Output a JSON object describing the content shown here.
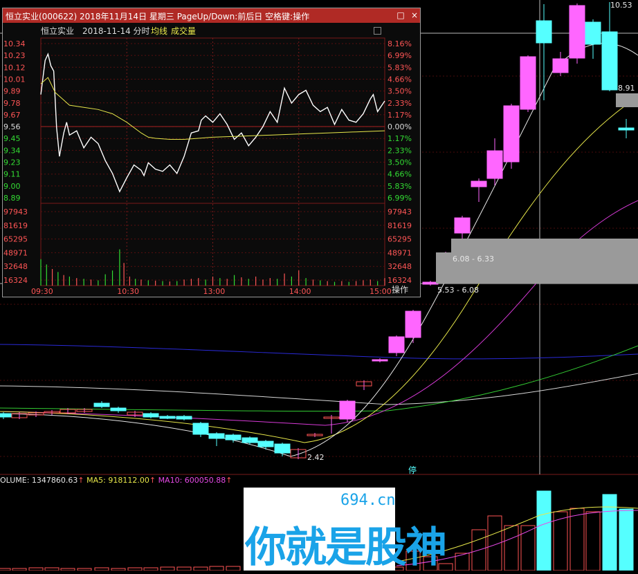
{
  "main_chart": {
    "annotations": {
      "high": "10.53",
      "ma_label": "8.91",
      "low": "2.42",
      "cost_1": "6.08 - 6.33",
      "cost_2": "5.53 - 6.08",
      "marker": "停"
    },
    "volume_legend": {
      "volume": "OLUME: 1347860.63",
      "ma5": "MA5: 918112.00",
      "ma10": "MA10: 600050.88",
      "colors": {
        "volume": "#e8e8e8",
        "ma5": "#e8e84a",
        "ma10": "#e84ae8",
        "up": "#ff5555",
        "down": "#55ffff"
      }
    }
  },
  "popup": {
    "title": "恒立实业(000622) 2018年11月14日 星期三 PageUp/Down:前后日 空格键:操作",
    "stock_name": "恒立实业",
    "date_label": "2018-11-14 分时",
    "avg_label": "均线",
    "vol_label": "成交量",
    "minimize_icon": "□",
    "close_icon": "×",
    "operate_label": "操作"
  },
  "chart_data": {
    "type": "line",
    "title": "恒立实业 2018-11-14 分时",
    "price_ticks": [
      "10.34",
      "10.23",
      "10.12",
      "10.01",
      "9.89",
      "9.78",
      "9.67",
      "9.56",
      "9.45",
      "9.34",
      "9.23",
      "9.11",
      "9.00",
      "8.89"
    ],
    "pct_ticks": [
      "8.16%",
      "6.99%",
      "5.83%",
      "4.66%",
      "3.50%",
      "2.33%",
      "1.17%",
      "0.00%",
      "1.17%",
      "2.33%",
      "3.50%",
      "4.66%",
      "5.83%",
      "6.99%"
    ],
    "volume_ticks": [
      "97943",
      "81619",
      "65295",
      "48971",
      "32648",
      "16324"
    ],
    "time_ticks": [
      "09:30",
      "10:30",
      "13:00",
      "14:00",
      "15:00"
    ],
    "prev_close": 9.56,
    "ylim": [
      8.84,
      10.39
    ],
    "series": [
      {
        "name": "分时",
        "color": "#ffffff",
        "x": [
          0,
          3,
          5,
          7,
          9,
          11,
          13,
          16,
          18,
          20,
          25,
          30,
          35,
          40,
          45,
          50,
          55,
          60,
          65,
          70,
          72,
          75,
          80,
          85,
          90,
          95,
          100,
          105,
          110,
          112,
          115,
          120,
          125,
          130,
          135,
          140,
          145,
          150,
          155,
          160,
          165,
          170,
          175,
          180,
          185,
          190,
          195,
          200,
          205,
          210,
          215,
          220,
          225,
          230,
          232,
          235,
          240
        ],
        "y": [
          9.86,
          10.18,
          10.24,
          10.13,
          10.08,
          9.55,
          9.28,
          9.5,
          9.6,
          9.48,
          9.52,
          9.36,
          9.46,
          9.4,
          9.24,
          9.12,
          8.95,
          9.08,
          9.2,
          9.15,
          9.1,
          9.22,
          9.16,
          9.14,
          9.2,
          9.12,
          9.28,
          9.5,
          9.52,
          9.62,
          9.66,
          9.6,
          9.68,
          9.58,
          9.44,
          9.5,
          9.38,
          9.46,
          9.56,
          9.7,
          9.6,
          9.92,
          9.78,
          9.86,
          9.9,
          9.76,
          9.7,
          9.74,
          9.58,
          9.72,
          9.62,
          9.6,
          9.68,
          9.82,
          9.86,
          9.7,
          9.8
        ]
      },
      {
        "name": "均线",
        "color": "#e8e84a",
        "x": [
          0,
          5,
          10,
          15,
          20,
          30,
          40,
          50,
          60,
          70,
          75,
          80,
          90,
          100,
          110,
          120,
          140,
          160,
          180,
          200,
          220,
          240
        ],
        "y": [
          9.96,
          10.02,
          9.88,
          9.82,
          9.76,
          9.74,
          9.72,
          9.68,
          9.6,
          9.5,
          9.46,
          9.45,
          9.44,
          9.44,
          9.45,
          9.46,
          9.47,
          9.48,
          9.49,
          9.5,
          9.51,
          9.52
        ]
      }
    ],
    "volume_max": 97943,
    "volume_bars": [
      {
        "t": 0,
        "v": 35000,
        "up": false
      },
      {
        "t": 4,
        "v": 28000,
        "up": false
      },
      {
        "t": 8,
        "v": 22000,
        "up": true
      },
      {
        "t": 12,
        "v": 18000,
        "up": false
      },
      {
        "t": 16,
        "v": 14000,
        "up": true
      },
      {
        "t": 20,
        "v": 12000,
        "up": false
      },
      {
        "t": 25,
        "v": 10000,
        "up": true
      },
      {
        "t": 30,
        "v": 9000,
        "up": false
      },
      {
        "t": 35,
        "v": 8000,
        "up": true
      },
      {
        "t": 40,
        "v": 7000,
        "up": false
      },
      {
        "t": 45,
        "v": 15000,
        "up": false
      },
      {
        "t": 50,
        "v": 20000,
        "up": false
      },
      {
        "t": 55,
        "v": 48000,
        "up": false
      },
      {
        "t": 58,
        "v": 30000,
        "up": true
      },
      {
        "t": 62,
        "v": 12000,
        "up": true
      },
      {
        "t": 66,
        "v": 9000,
        "up": false
      },
      {
        "t": 70,
        "v": 8000,
        "up": true
      },
      {
        "t": 75,
        "v": 7000,
        "up": false
      },
      {
        "t": 80,
        "v": 6500,
        "up": true
      },
      {
        "t": 85,
        "v": 6000,
        "up": false
      },
      {
        "t": 90,
        "v": 5500,
        "up": true
      },
      {
        "t": 95,
        "v": 6000,
        "up": false
      },
      {
        "t": 100,
        "v": 8000,
        "up": true
      },
      {
        "t": 105,
        "v": 9000,
        "up": true
      },
      {
        "t": 110,
        "v": 10000,
        "up": true
      },
      {
        "t": 115,
        "v": 8000,
        "up": false
      },
      {
        "t": 120,
        "v": 12000,
        "up": true
      },
      {
        "t": 125,
        "v": 10000,
        "up": false
      },
      {
        "t": 130,
        "v": 9000,
        "up": true
      },
      {
        "t": 135,
        "v": 14000,
        "up": false
      },
      {
        "t": 140,
        "v": 11000,
        "up": true
      },
      {
        "t": 145,
        "v": 9000,
        "up": false
      },
      {
        "t": 150,
        "v": 12000,
        "up": true
      },
      {
        "t": 155,
        "v": 8000,
        "up": true
      },
      {
        "t": 160,
        "v": 10000,
        "up": true
      },
      {
        "t": 165,
        "v": 9000,
        "up": false
      },
      {
        "t": 170,
        "v": 16000,
        "up": true
      },
      {
        "t": 175,
        "v": 12000,
        "up": false
      },
      {
        "t": 180,
        "v": 20000,
        "up": true
      },
      {
        "t": 185,
        "v": 10000,
        "up": false
      },
      {
        "t": 190,
        "v": 8000,
        "up": true
      },
      {
        "t": 195,
        "v": 7000,
        "up": false
      },
      {
        "t": 200,
        "v": 6000,
        "up": true
      },
      {
        "t": 205,
        "v": 5000,
        "up": false
      },
      {
        "t": 210,
        "v": 6000,
        "up": true
      },
      {
        "t": 215,
        "v": 5000,
        "up": false
      },
      {
        "t": 220,
        "v": 6000,
        "up": true
      },
      {
        "t": 225,
        "v": 7000,
        "up": true
      },
      {
        "t": 230,
        "v": 8000,
        "up": true
      },
      {
        "t": 235,
        "v": 6000,
        "up": false
      },
      {
        "t": 240,
        "v": 10000,
        "up": true
      }
    ]
  }
}
